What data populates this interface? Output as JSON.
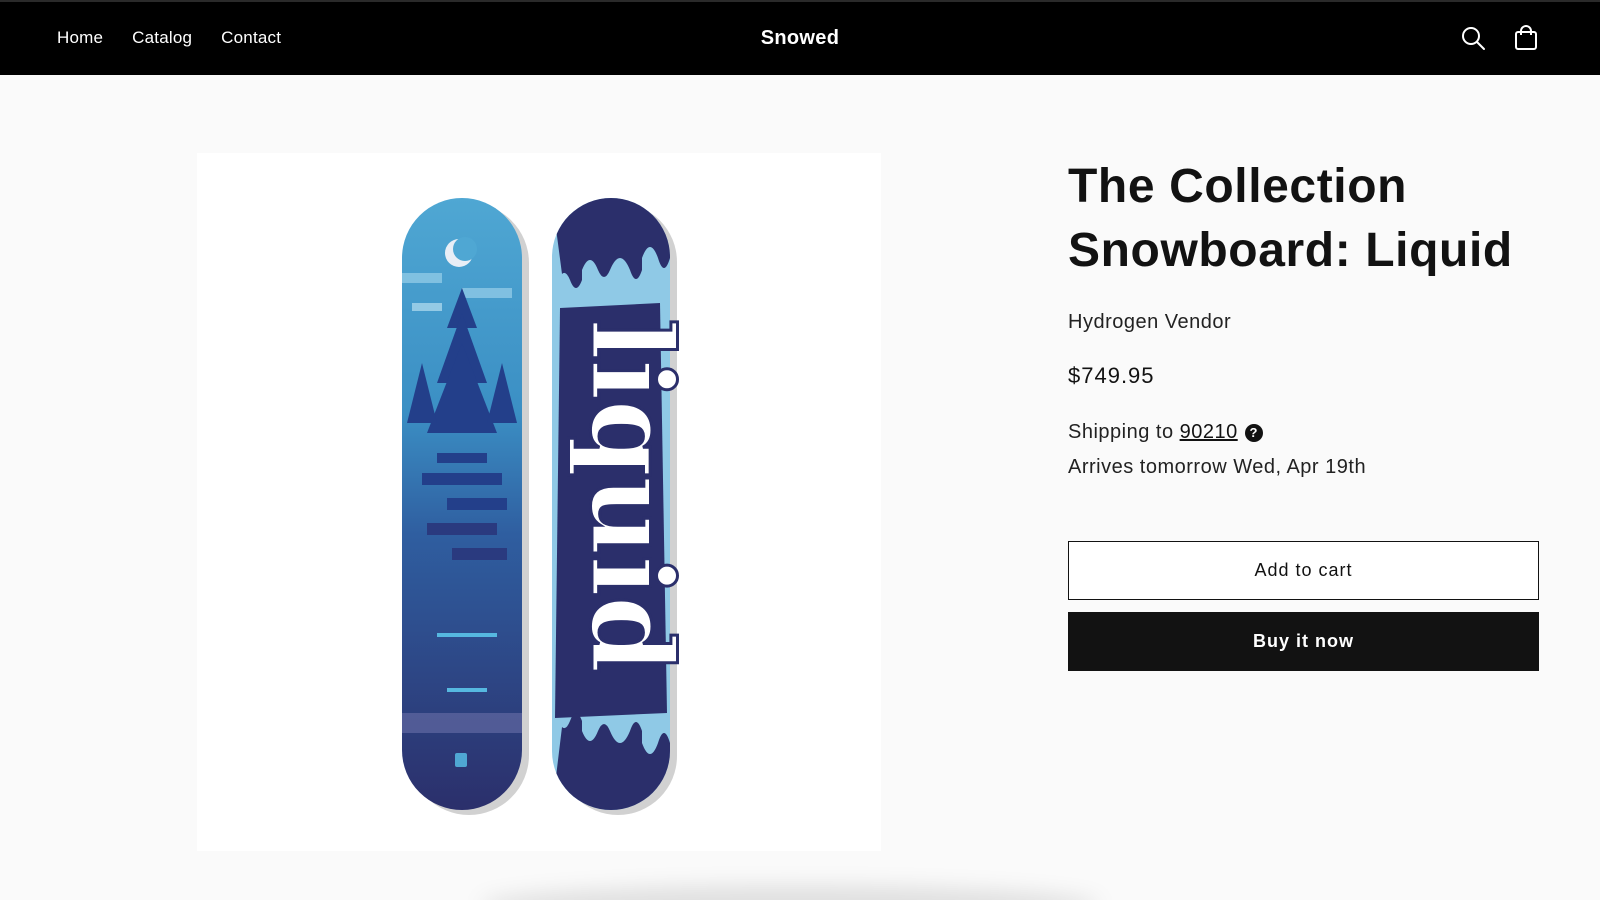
{
  "header": {
    "nav": [
      {
        "label": "Home"
      },
      {
        "label": "Catalog"
      },
      {
        "label": "Contact"
      }
    ],
    "brand": "Snowed",
    "icons": {
      "search": "search-icon",
      "cart": "cart-icon"
    }
  },
  "product": {
    "title_line1": "The Collection",
    "title_line2": "Snowboard: Liquid",
    "vendor": "Hydrogen Vendor",
    "price": "$749.95",
    "shipping_prefix": "Shipping to",
    "shipping_zip": "90210",
    "help_glyph": "?",
    "arrives": "Arrives tomorrow Wed, Apr 19th",
    "image_wordmark": "liquid"
  },
  "actions": {
    "add_to_cart": "Add to cart",
    "buy_now": "Buy it now"
  },
  "colors": {
    "header_bg": "#000000",
    "buy_button_bg": "#121212",
    "page_bg": "#fafafa",
    "board_dark": "#2b2f6b",
    "board_light": "#8fc9e6"
  }
}
